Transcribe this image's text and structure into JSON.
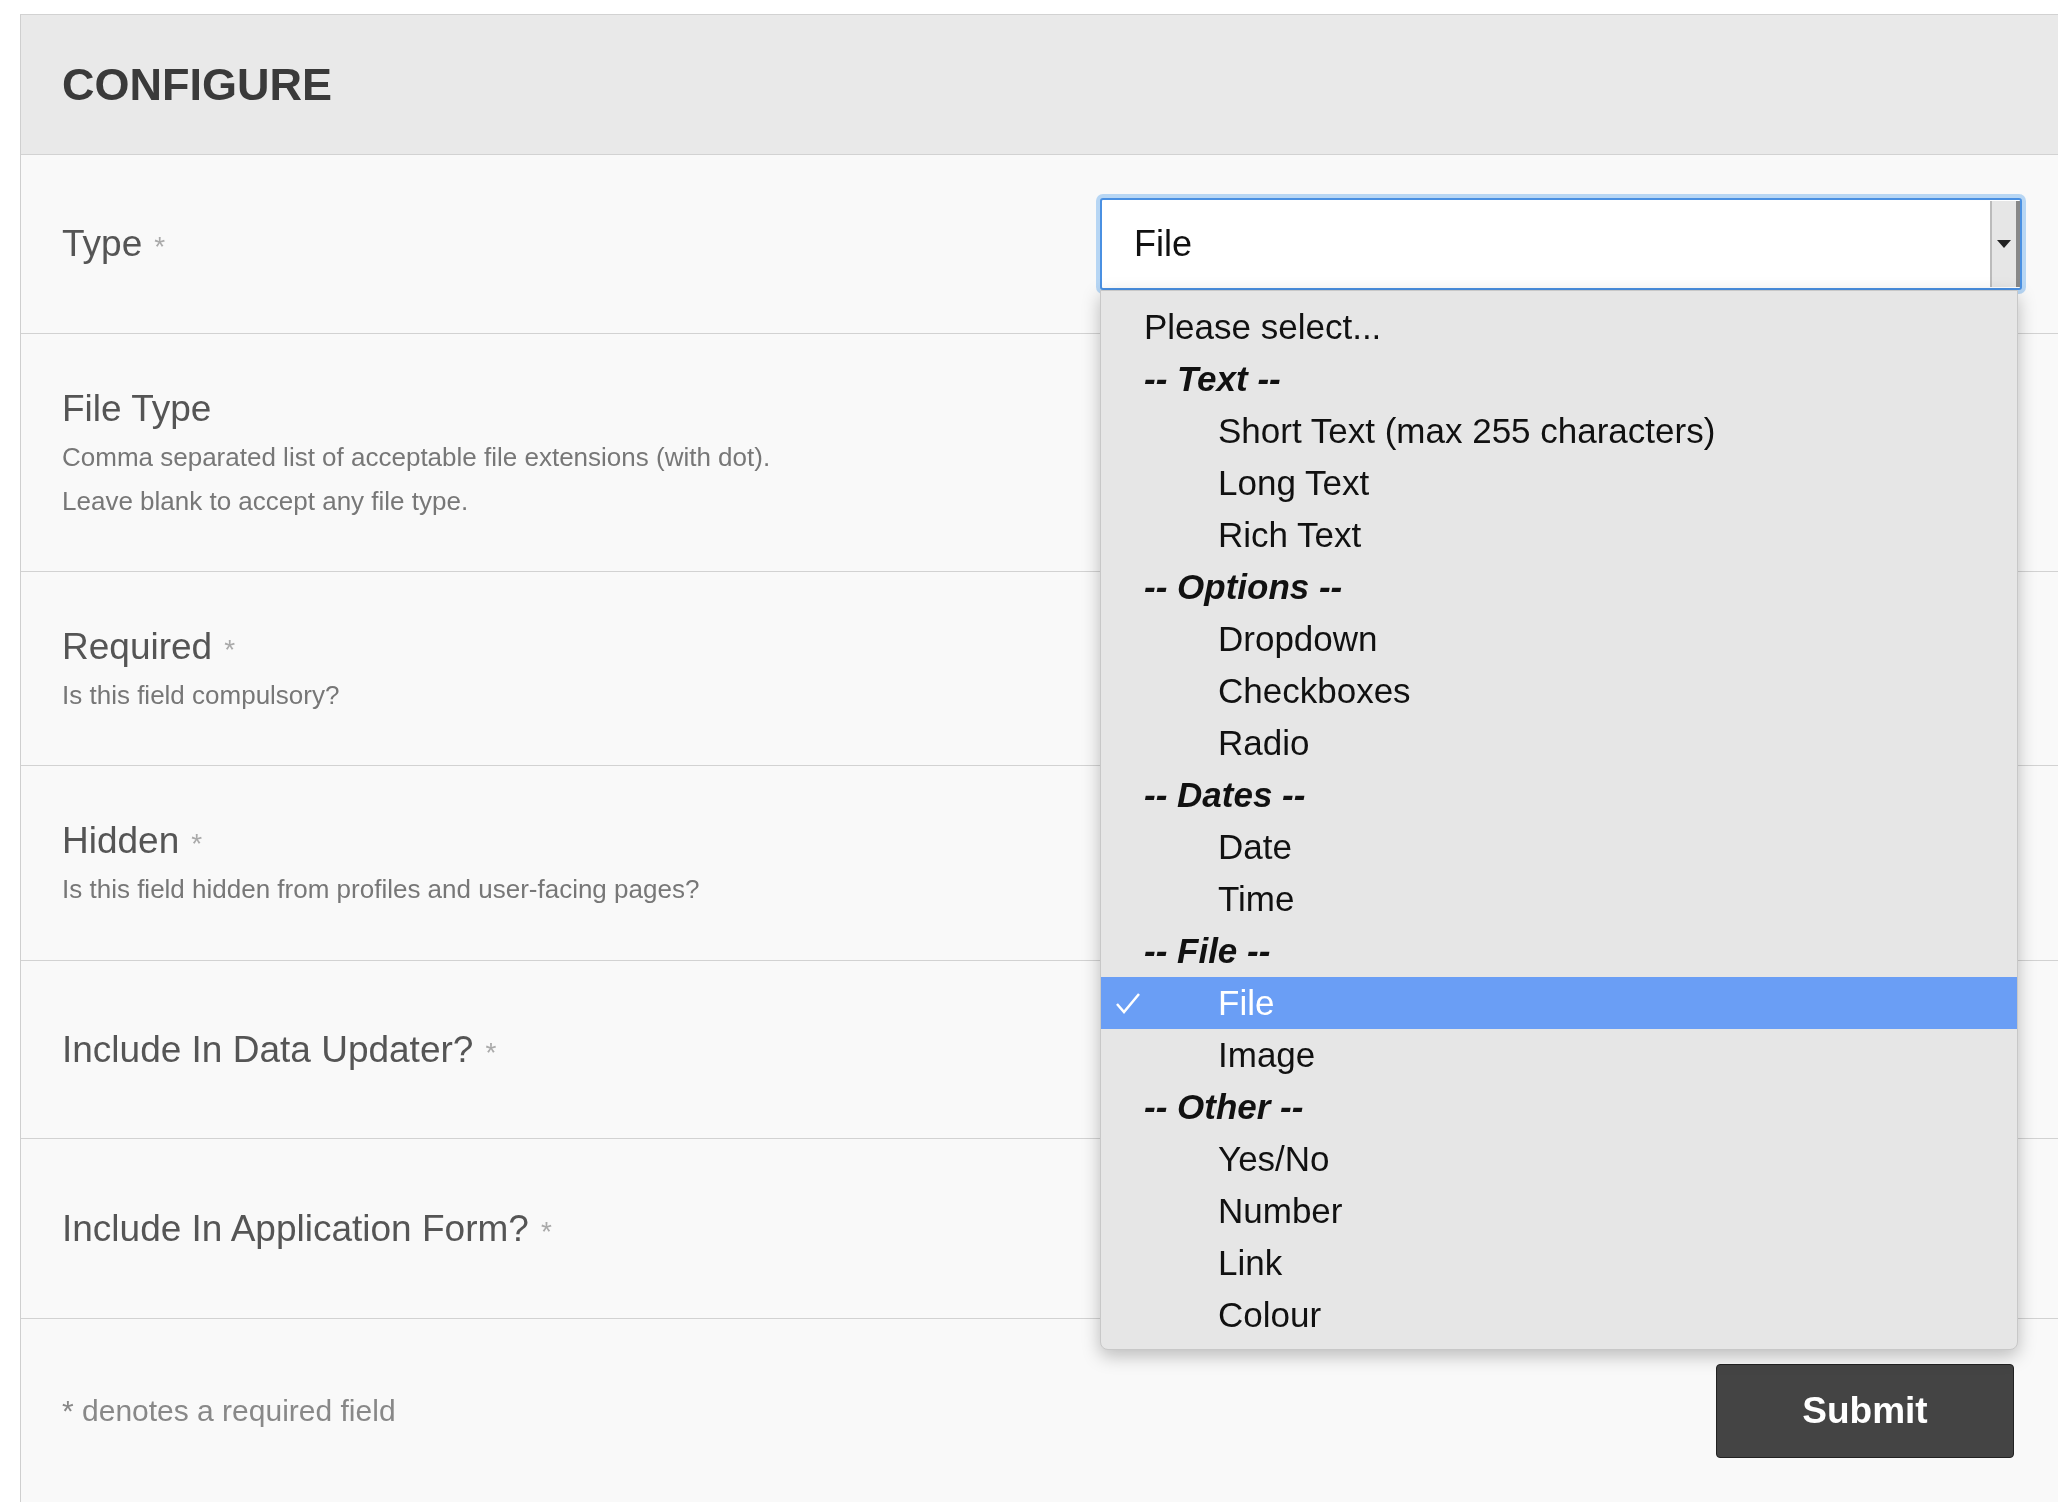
{
  "section": {
    "title": "CONFIGURE"
  },
  "fields": [
    {
      "label": "Type",
      "required_mark": "*",
      "control": {
        "kind": "select",
        "value": "File"
      }
    },
    {
      "label": "File Type",
      "description": [
        "Comma separated list of acceptable file extensions (with dot).",
        "Leave blank to accept any file type."
      ]
    },
    {
      "label": "Required",
      "required_mark": "*",
      "description": [
        "Is this field compulsory?"
      ]
    },
    {
      "label": "Hidden",
      "required_mark": "*",
      "description": [
        "Is this field hidden from profiles and user-facing pages?"
      ]
    },
    {
      "label": "Include In Data Updater?",
      "required_mark": "*"
    },
    {
      "label": "Include In Application Form?",
      "required_mark": "*"
    }
  ],
  "dropdown": {
    "options": [
      {
        "kind": "option",
        "label": "Please select...",
        "selected": false
      },
      {
        "kind": "group",
        "label": "-- Text --"
      },
      {
        "kind": "suboption",
        "label": "Short Text (max 255 characters)",
        "selected": false
      },
      {
        "kind": "suboption",
        "label": "Long Text",
        "selected": false
      },
      {
        "kind": "suboption",
        "label": "Rich Text",
        "selected": false
      },
      {
        "kind": "group",
        "label": "-- Options --"
      },
      {
        "kind": "suboption",
        "label": "Dropdown",
        "selected": false
      },
      {
        "kind": "suboption",
        "label": "Checkboxes",
        "selected": false
      },
      {
        "kind": "suboption",
        "label": "Radio",
        "selected": false
      },
      {
        "kind": "group",
        "label": "-- Dates --"
      },
      {
        "kind": "suboption",
        "label": "Date",
        "selected": false
      },
      {
        "kind": "suboption",
        "label": "Time",
        "selected": false
      },
      {
        "kind": "group",
        "label": "-- File --"
      },
      {
        "kind": "suboption",
        "label": "File",
        "selected": true
      },
      {
        "kind": "suboption",
        "label": "Image",
        "selected": false
      },
      {
        "kind": "group",
        "label": "-- Other --"
      },
      {
        "kind": "suboption",
        "label": "Yes/No",
        "selected": false
      },
      {
        "kind": "suboption",
        "label": "Number",
        "selected": false
      },
      {
        "kind": "suboption",
        "label": "Link",
        "selected": false
      },
      {
        "kind": "suboption",
        "label": "Colour",
        "selected": false
      }
    ]
  },
  "footer": {
    "note": "* denotes a required field",
    "submit": "Submit"
  }
}
